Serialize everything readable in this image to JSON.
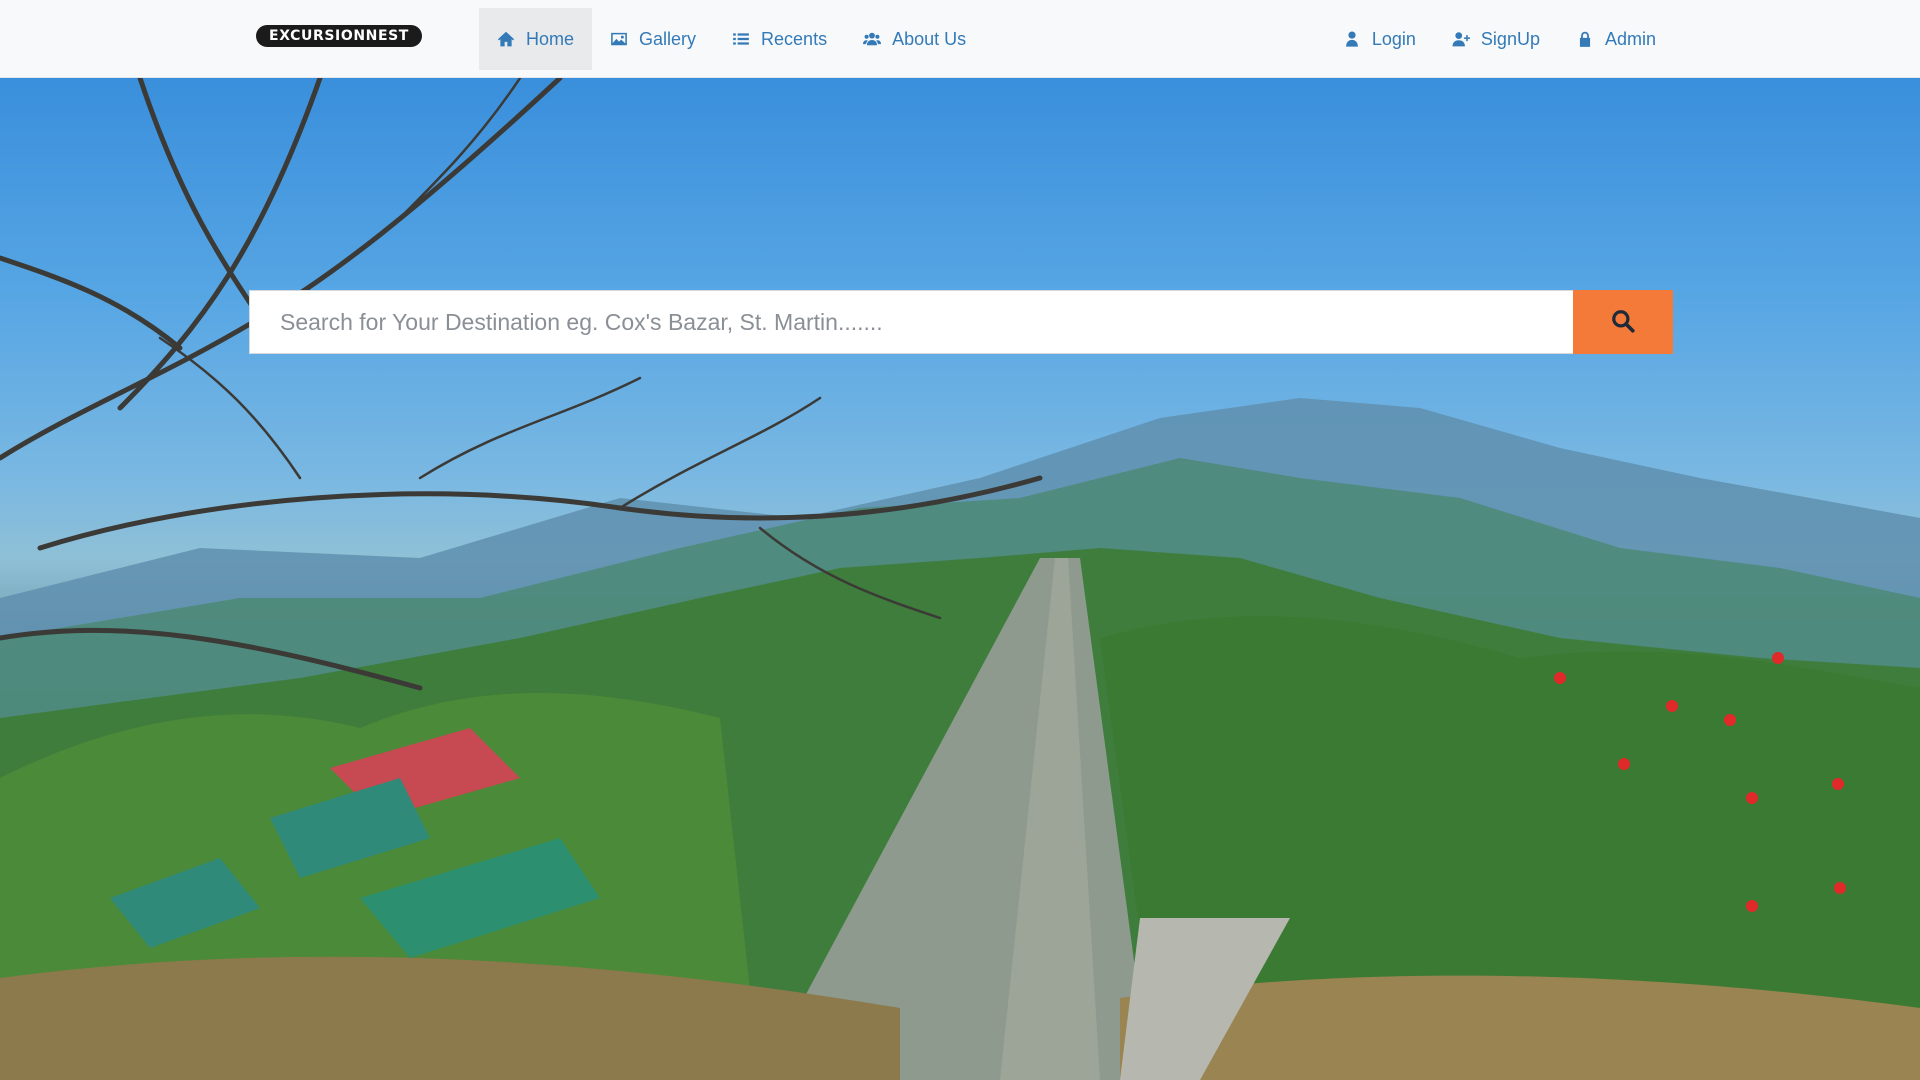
{
  "brand": {
    "logo_text": "EXCURSIONNEST"
  },
  "nav": {
    "left": [
      {
        "label": "Home",
        "icon": "home-icon",
        "active": true
      },
      {
        "label": "Gallery",
        "icon": "image-icon",
        "active": false
      },
      {
        "label": "Recents",
        "icon": "list-icon",
        "active": false
      },
      {
        "label": "About Us",
        "icon": "users-icon",
        "active": false
      }
    ],
    "right": [
      {
        "label": "Login",
        "icon": "user-icon"
      },
      {
        "label": "SignUp",
        "icon": "user-plus-icon"
      },
      {
        "label": "Admin",
        "icon": "lock-icon"
      }
    ]
  },
  "search": {
    "placeholder": "Search for Your Destination eg. Cox's Bazar, St. Martin.......",
    "value": "",
    "button_icon": "search-icon"
  },
  "colors": {
    "link": "#337ab7",
    "nav_bg": "#f8f9fb",
    "active_bg": "#e9eaec",
    "search_button": "#f47a3a"
  }
}
